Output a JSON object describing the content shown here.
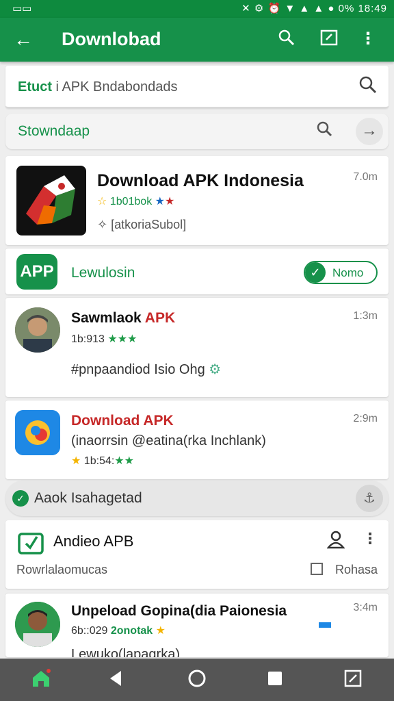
{
  "status": {
    "right": "✕ ⚙ ⏰ ▼ ▲ ▲ ● 0% 18:49"
  },
  "appbar": {
    "title": "Downlobad"
  },
  "search_primary": {
    "value_bold": "Etuct",
    "value_rest": " i APK Bndabondads"
  },
  "search_secondary": {
    "value": "Stowndaap"
  },
  "hero": {
    "name": "Download APK Indonesia",
    "time": "7.0m",
    "rating": "1b01bok",
    "developer": "[atkoriaSubol]"
  },
  "app_row": {
    "badge": "APP",
    "label": "Lewulosin",
    "toggle_label": "Nomo"
  },
  "rows": [
    {
      "name_a": "Sawmlaok ",
      "name_b": "APK",
      "time": "1:3m",
      "meta": "1b:913",
      "stars": "★★★",
      "desc": "#pnpaandiod Isio Ohg"
    },
    {
      "name": "Download APK",
      "time": "2:9m",
      "desc": "(inaorrsin @eatina(rka Inchlank)",
      "meta": "1b:54:",
      "stars": "★★"
    },
    {
      "name": "Unpeload Gopina(dia Paionesia",
      "time": "3:4m",
      "meta": "6b::029",
      "meta_b": "2onotak",
      "desc": "Lewuko(lapagrka)"
    }
  ],
  "notice": {
    "label": "Aaok Isahagetad"
  },
  "listitem": {
    "name": "Andieo APB",
    "sub": "Rowrlalaomucas",
    "check_label": "Rohasa"
  },
  "colors": {
    "primary": "#16914a",
    "status_bar": "#0e8a3e",
    "accent_red": "#c62828",
    "star_gold": "#f4b400",
    "nav_bar": "#555555"
  },
  "icons": {
    "back": "arrow-left-icon",
    "search": "search-icon",
    "edit": "edit-square-icon",
    "more": "more-vert-icon"
  }
}
